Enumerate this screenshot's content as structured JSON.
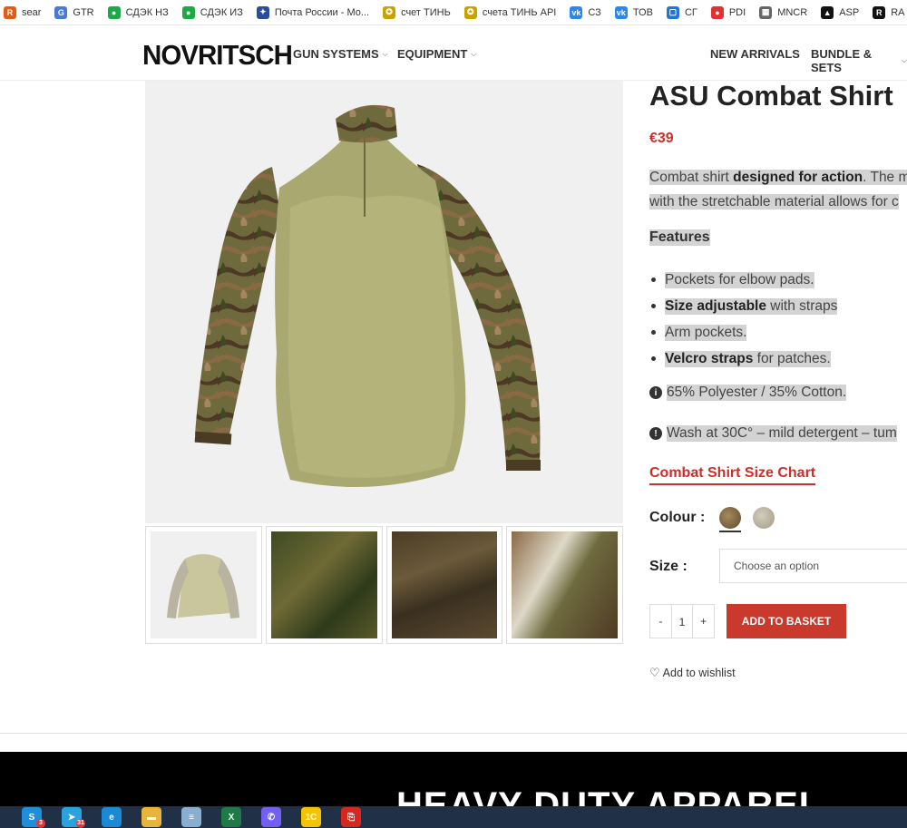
{
  "bookmarks": [
    {
      "label": "sear",
      "icon": "r-icon",
      "color": "#e55b13",
      "glyph": "R"
    },
    {
      "label": "GTR",
      "icon": "translate-icon",
      "color": "#4a7bd0",
      "glyph": "G"
    },
    {
      "label": "СДЭК НЗ",
      "icon": "cdek-icon",
      "color": "#1ea848",
      "glyph": "●"
    },
    {
      "label": "СДЭК ИЗ",
      "icon": "cdek-icon",
      "color": "#1ea848",
      "glyph": "●"
    },
    {
      "label": "Почта России - Мо...",
      "icon": "eagle-icon",
      "color": "#2a4d9b",
      "glyph": "✦"
    },
    {
      "label": "счет ТИНЬ",
      "icon": "tinkoff-icon",
      "color": "#c8a200",
      "glyph": "✪"
    },
    {
      "label": "счета ТИНЬ API",
      "icon": "tinkoff-icon",
      "color": "#c8a200",
      "glyph": "✪"
    },
    {
      "label": "СЗ",
      "icon": "vk-icon",
      "color": "#2787f5",
      "glyph": "vk"
    },
    {
      "label": "ТОВ",
      "icon": "vk-icon",
      "color": "#2787f5",
      "glyph": "vk"
    },
    {
      "label": "СГ",
      "icon": "chat-icon",
      "color": "#1d77d8",
      "glyph": "▢"
    },
    {
      "label": "PDI",
      "icon": "pdi-icon",
      "color": "#d33",
      "glyph": "●"
    },
    {
      "label": "MNCR",
      "icon": "grid-icon",
      "color": "#666",
      "glyph": "▦"
    },
    {
      "label": "ASP",
      "icon": "asp-icon",
      "color": "#111",
      "glyph": "▲"
    },
    {
      "label": "RA",
      "icon": "ra-icon",
      "color": "#111",
      "glyph": "R"
    }
  ],
  "header": {
    "logo": "NOVRITSCH",
    "nav_left": [
      "GUN SYSTEMS",
      "EQUIPMENT"
    ],
    "nav_right": [
      "NEW ARRIVALS",
      "BUNDLE & SETS"
    ]
  },
  "product": {
    "title": "ASU Combat Shirt",
    "price": "€39",
    "desc_line1_a": "Combat shirt ",
    "desc_line1_b": "designed for action",
    "desc_line1_c": ". The m",
    "desc_line2": "with the stretchable material allows for c",
    "features_heading": "Features",
    "features": [
      {
        "bold": "",
        "text": "Pockets for elbow pads."
      },
      {
        "bold": "Size adjustable",
        "text": " with straps"
      },
      {
        "bold": "",
        "text": "Arm pockets."
      },
      {
        "bold": "Velcro straps",
        "text": " for patches."
      }
    ],
    "material": "65% Polyester / 35% Cotton.",
    "care": "Wash at 30C° – mild detergent – tum",
    "size_chart_link": "Combat Shirt Size Chart",
    "colour_label": "Colour :",
    "colours": [
      "#7d6a4a",
      "#b8b3a2"
    ],
    "size_label": "Size :",
    "size_placeholder": "Choose an option",
    "qty_minus": "-",
    "qty_value": "1",
    "qty_plus": "+",
    "add_button": "ADD TO BASKET",
    "wishlist": "Add to wishlist"
  },
  "banner": {
    "text": "HEAVY DUTY APPAREL"
  },
  "taskbar": [
    {
      "icon": "skype-icon",
      "color": "#1f8fdc",
      "glyph": "S",
      "badge": "3"
    },
    {
      "icon": "telegram-icon",
      "color": "#2aa3dd",
      "glyph": "➤",
      "badge": "31"
    },
    {
      "icon": "edge-icon",
      "color": "#1b8ad6",
      "glyph": "e",
      "badge": ""
    },
    {
      "icon": "folder-icon",
      "color": "#e8b53b",
      "glyph": "▬",
      "badge": ""
    },
    {
      "icon": "notepad-icon",
      "color": "#8aaed0",
      "glyph": "≡",
      "badge": ""
    },
    {
      "icon": "excel-icon",
      "color": "#1f7a46",
      "glyph": "X",
      "badge": ""
    },
    {
      "icon": "viber-icon",
      "color": "#7360f2",
      "glyph": "✆",
      "badge": ""
    },
    {
      "icon": "1c-icon",
      "color": "#f5c400",
      "glyph": "1С",
      "badge": ""
    },
    {
      "icon": "pdf-icon",
      "color": "#d6281e",
      "glyph": "⎘",
      "badge": ""
    }
  ]
}
